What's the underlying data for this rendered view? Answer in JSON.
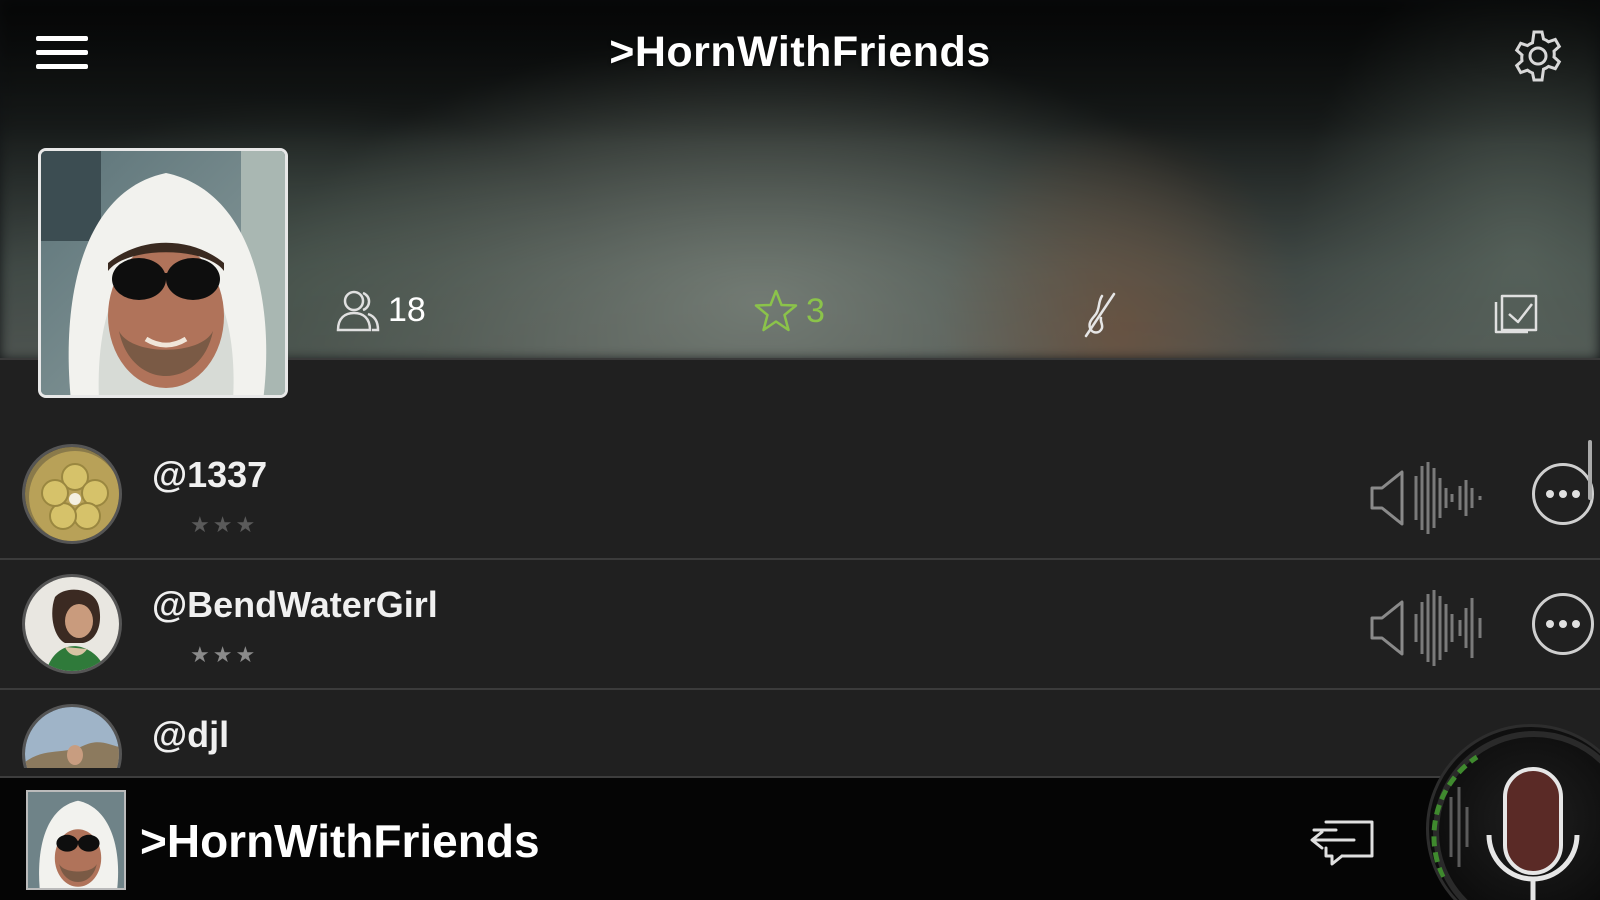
{
  "header": {
    "title": ">HornWithFriends",
    "menu_icon": "hamburger-menu-icon",
    "settings_icon": "gear-icon"
  },
  "channel": {
    "photo": "channel-photo",
    "members_count": "18",
    "favorites_count": "3",
    "favorites_color": "#8bc34a"
  },
  "members": [
    {
      "handle": "@1337",
      "stars": "★★★",
      "rating": "0 of 3",
      "star_color": "#5a5a5a"
    },
    {
      "handle": "@BendWaterGirl",
      "stars": "★★★",
      "rating": "3 of 3",
      "star_color": "#8a8a8a"
    },
    {
      "handle": "@djl"
    }
  ],
  "bottom_bar": {
    "title": ">HornWithFriends",
    "exit_icon": "exit-channel-icon",
    "mic_icon": "microphone-icon"
  }
}
